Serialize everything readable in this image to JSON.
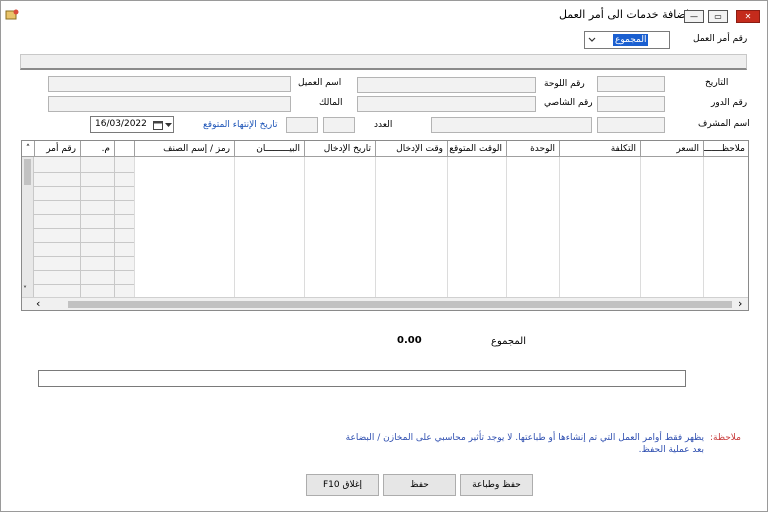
{
  "window": {
    "title": "إضافة خدمات الى أمر العمل",
    "minimize_glyph": "—",
    "restore_glyph": "▭",
    "close_glyph": "✕",
    "icon": "app-form-icon"
  },
  "header": {
    "work_order_label": "رقم أمر العمل",
    "work_order_value": "المجموع"
  },
  "form": {
    "date_label": "التاريخ",
    "plate_label": "رقم اللوحة",
    "customer_name_label": "اسم العميل",
    "turn_label": "رقم الدور",
    "chassis_label": "رقم الشاصي",
    "owner_label": "المالك",
    "supervisor_label": "اسم المشرف",
    "count_label": "العدد",
    "expected_end_label": "تاريخ الإنتهاء المتوقع",
    "expected_end_value": "16/03/2022"
  },
  "grid": {
    "columns": [
      "رقم أمر",
      "م.",
      "",
      "رمز / إسم الصنف",
      "البيـــــــــان",
      "تاريخ الإدخال",
      "وقت الإدخال",
      "الوقت المتوقع",
      "الوحدة",
      "التكلفة",
      "السعر",
      "ملاحظـــــــات"
    ],
    "scroll_left": "‹",
    "scroll_right": "›",
    "scroll_up": "˄",
    "scroll_down": "˅"
  },
  "totals": {
    "label": "المجموع",
    "value": "0.00"
  },
  "note": {
    "label": "ملاحظة:",
    "text_line1": "يظهر فقط أوامر العمل التي تم إنشاءها أو طباعتها. لا يوجد تأثير محاسبي على المخازن / البضاعة",
    "text_line2": "بعد عملية الحفظ."
  },
  "buttons": {
    "close": "إغلاق F10",
    "save": "حفظ",
    "save_print": "حفظ وطباعة"
  },
  "colors": {
    "close_button": "#c42b1c",
    "note_label": "#c83b3b",
    "note_text": "#2f4fb0",
    "link_label": "#1f56b8",
    "selection": "#1a5fd0"
  }
}
